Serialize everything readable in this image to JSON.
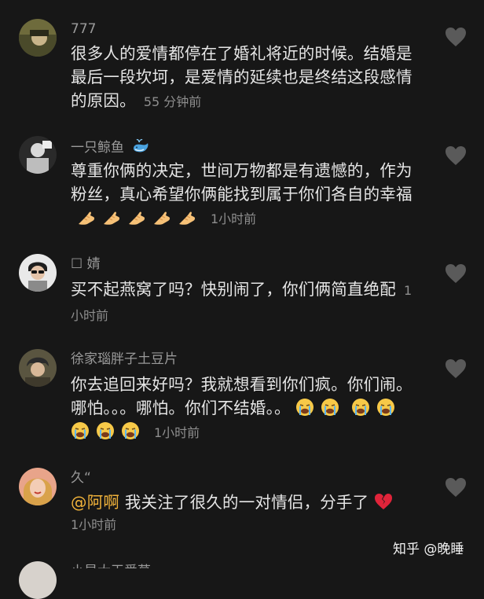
{
  "comments": [
    {
      "username": "777",
      "text": "很多人的爱情都停在了婚礼将近的时候。结婚是最后一段坎坷，是爱情的延续也是终结这段感情的原因。",
      "time": "55 分钟前"
    },
    {
      "username": "一只鲸鱼",
      "text": "尊重你俩的决定，世间万物都是有遗憾的，作为粉丝，真心希望你俩能找到属于你们各自的幸福",
      "time": "1小时前"
    },
    {
      "username": "☐ 婧",
      "text": "买不起燕窝了吗？快别闹了，你们俩简直绝配",
      "time": "1小时前"
    },
    {
      "username": "徐家瑙胖子土豆片",
      "text": "你去追回来好吗？我就想看到你们疯。你们闹。哪怕。。。哪怕。你们不结婚。。",
      "time": "1小时前"
    },
    {
      "username": "久“",
      "mention": "@阿啊",
      "text": "我关注了很久的一对情侣，分手了",
      "time": "1小时前"
    },
    {
      "username": "小星大王爱草"
    }
  ],
  "watermark": "知乎 @晚睡",
  "colors": {
    "background": "#171717",
    "text": "#e6e6e6",
    "muted": "#8e8e8e",
    "mention": "#f0b23a"
  },
  "icons": [
    "heart-outline-icon",
    "whale-emoji",
    "pinched-hand-emoji",
    "crying-face-emoji",
    "broken-heart-emoji"
  ]
}
